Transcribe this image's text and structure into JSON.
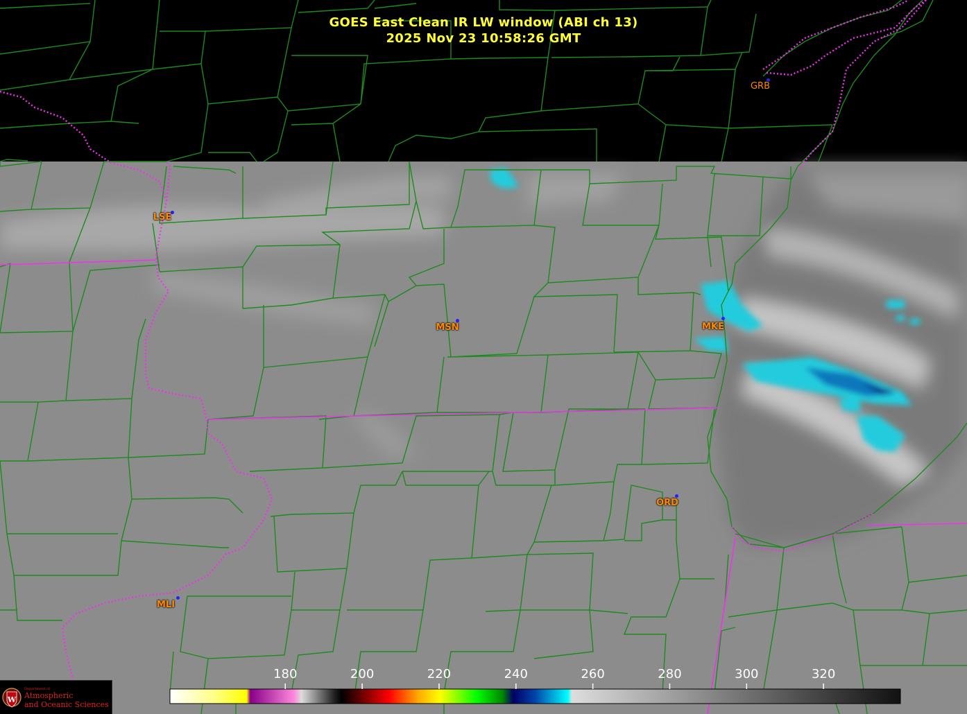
{
  "title": {
    "line1": "GOES East Clean IR LW window (ABI ch 13)",
    "line2": "2025 Nov 23  10:58:26 GMT"
  },
  "colors": {
    "title": "#ffff33",
    "station_label": "#ff8800",
    "station_dot": "#2222ff",
    "county_lines": "#1e8a1e",
    "state_lines": "#ee33ee",
    "cloud_cyan": "#22ccdd",
    "cloud_blue": "#1177bb"
  },
  "stations": [
    {
      "id": "GRB"
    },
    {
      "id": "LSE"
    },
    {
      "id": "MSN"
    },
    {
      "id": "MKE"
    },
    {
      "id": "ORD"
    },
    {
      "id": "MLI"
    }
  ],
  "colorbar": {
    "unit_range": [
      150,
      340
    ],
    "ticks": [
      "180",
      "200",
      "220",
      "240",
      "260",
      "280",
      "300",
      "320"
    ],
    "tick_values": [
      180,
      200,
      220,
      240,
      260,
      280,
      300,
      320
    ]
  },
  "logo": {
    "department": "Department of",
    "line1": "Atmospheric",
    "line2": "and Oceanic Sciences",
    "icon": "uw-crest-icon"
  }
}
